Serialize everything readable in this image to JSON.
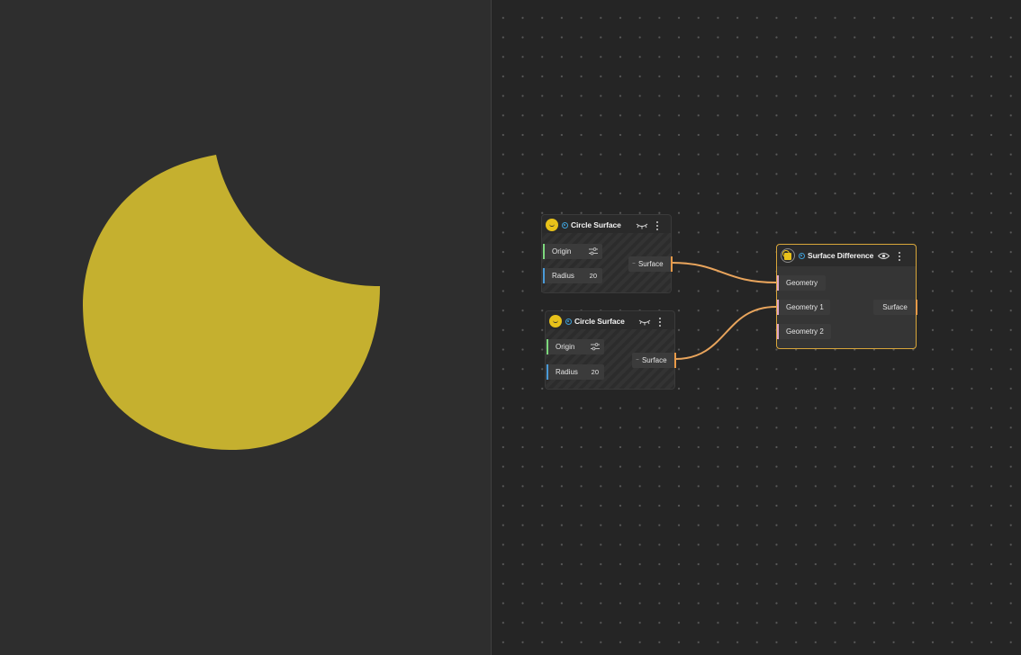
{
  "nodes": {
    "circle1": {
      "title": "Circle Surface",
      "inputs": [
        {
          "label": "Origin",
          "value": ""
        },
        {
          "label": "Radius",
          "value": "20"
        }
      ],
      "output": "Surface"
    },
    "circle2": {
      "title": "Circle Surface",
      "inputs": [
        {
          "label": "Origin",
          "value": ""
        },
        {
          "label": "Radius",
          "value": "20"
        }
      ],
      "output": "Surface"
    },
    "difference": {
      "title": "Surface Difference",
      "inputs": [
        {
          "label": "Geometry"
        },
        {
          "label": "Geometry 1"
        },
        {
          "label": "Geometry 2"
        }
      ],
      "output": "Surface"
    }
  },
  "colors": {
    "shape_fill": "#c5b02f",
    "wire": "#e8a45c",
    "selected_border": "#d9a63a",
    "origin_port": "#7dd87d",
    "radius_port": "#4a9ad8",
    "geometry_port": "#e0a8c8"
  },
  "icons": [
    "circle-surface-icon",
    "eye-closed-icon",
    "eye-icon",
    "more-vertical-icon",
    "sliders-icon",
    "surface-difference-icon"
  ]
}
